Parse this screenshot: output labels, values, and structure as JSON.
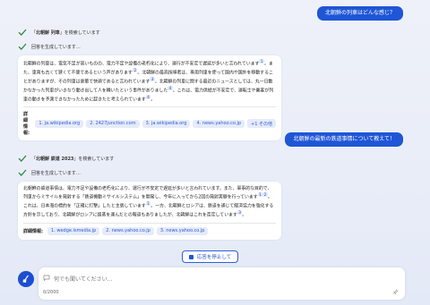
{
  "conversation": {
    "user_messages": [
      "北朝鮮の列車はどんな感じ？",
      "北朝鮮の最新の鉄道事情について教えて！"
    ],
    "turns": [
      {
        "search_prefix": "「",
        "search_query": "北朝鮮 列車",
        "search_suffix": "」を検索しています",
        "generating": "回答を生成しています…",
        "answer": [
          {
            "t": "北朝鮮の列車は、電気不足が高いものの、電力不足や設備の老朽化により、運行が不安定で遅延が多いと言われています"
          },
          {
            "c": "1"
          },
          {
            "t": "。また、車両も古くて狭くて不便であるという声があります"
          },
          {
            "c": "2"
          },
          {
            "t": "。北朝鮮の最高指導者は、専用列車を使って国内や国外を移動することがありますが、その列車は豪華で快適であると言われています"
          },
          {
            "c": "3"
          },
          {
            "t": "。北朝鮮の列車に関する最近のニュースとしては、丸一日動かなかった列車がいきなり動き出して人を轢いたという事件がありました"
          },
          {
            "c": "4"
          },
          {
            "t": "。これは、電力供給が不安定で、運転士や乗客が列車の動きを予測できなかったために起きたと考えられています"
          },
          {
            "c": "4"
          },
          {
            "t": "。"
          }
        ],
        "sources_label": "詳細情報:",
        "sources": [
          "1. ja.wikipedia.org",
          "2. 2427junction.com",
          "3. ja.wikipedia.org",
          "4. news.yahoo.co.jp",
          "+1 その他"
        ]
      },
      {
        "search_prefix": "「",
        "search_query": "北朝鮮 鉄道 2023",
        "search_suffix": "」を検索しています",
        "generating": "回答を生成しています…",
        "answer": [
          {
            "t": "北朝鮮の鉄道事情は、電力不足や設備の老朽化により、運行が不安定で遅延が多いと言われています。また、軍事的な目的で、列車からミサイルを発射する「鉄道機動ミサイルシステム」を開発し、今年に入ってから2回の発射実験を行っています"
          },
          {
            "c": "1"
          },
          {
            "c": "2"
          },
          {
            "t": "。これは、日本海の標的を「正確に打撃」したと主張しています"
          },
          {
            "c": "1"
          },
          {
            "t": "。一方、北朝鮮とロシアは、鉄道を通じて経済協力を強化する方針を示しており、北朝鮮がロシアに援蒸を運んだとの報道もありましたが、北朝鮮はこれを否定しています"
          },
          {
            "c": "3"
          },
          {
            "t": "。"
          }
        ],
        "sources_label": "詳細情報:",
        "sources": [
          "1. wedge.ismedia.jp",
          "2. news.yahoo.co.jp",
          "3. news.yahoo.co.jp"
        ]
      }
    ]
  },
  "stop_button": {
    "label": "応答を停止して"
  },
  "composer": {
    "placeholder": "何でも聞いてください...",
    "char_count": "0/2000"
  },
  "colors": {
    "accent": "#1f56d6",
    "check": "#2e8b3a",
    "chip_bg": "#e5ebfa"
  }
}
